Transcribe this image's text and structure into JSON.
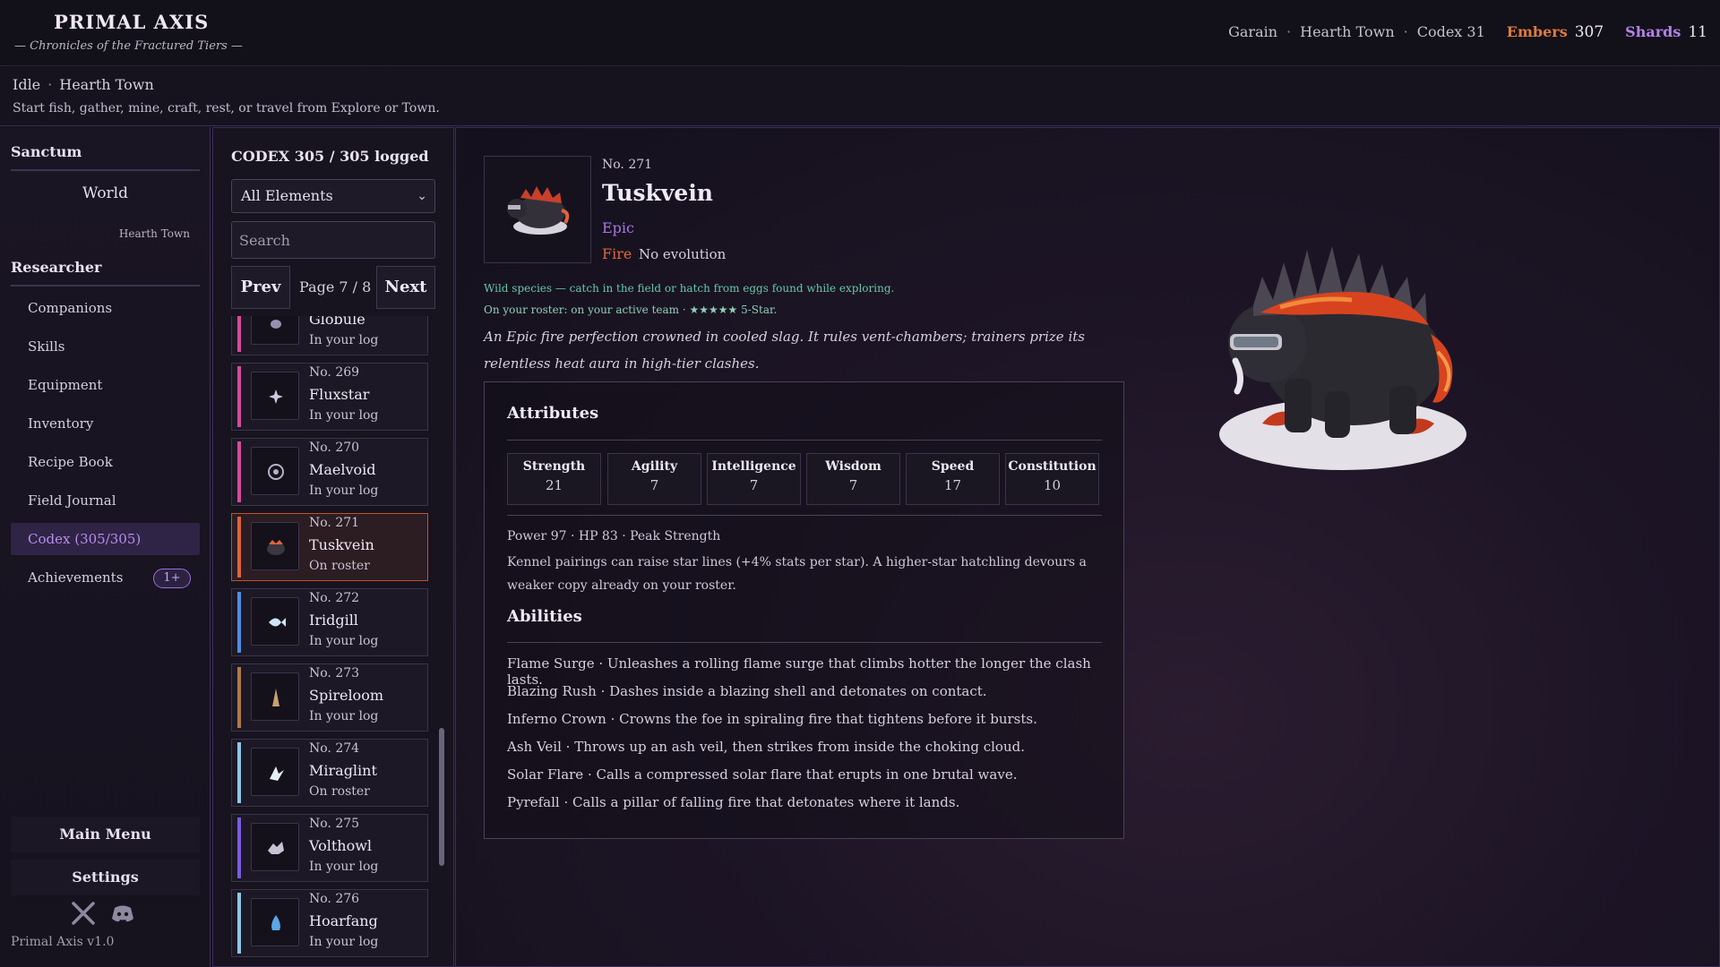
{
  "header": {
    "title": "PRIMAL AXIS",
    "subtitle": "— Chronicles of the Fractured Tiers —",
    "player": "Garain",
    "location": "Hearth Town",
    "codex": "Codex 31",
    "embers_label": "Embers",
    "embers_value": "307",
    "shards_label": "Shards",
    "shards_value": "11"
  },
  "status": {
    "state": "Idle",
    "location": "Hearth Town",
    "hint": "Start fish, gather, mine, craft, rest, or travel from Explore or Town."
  },
  "sidebar": {
    "sanctum": "Sanctum",
    "world": "World",
    "world_sub": "Hearth Town",
    "researcher": "Researcher",
    "items": [
      {
        "label": "Companions"
      },
      {
        "label": "Skills"
      },
      {
        "label": "Equipment"
      },
      {
        "label": "Inventory"
      },
      {
        "label": "Recipe Book"
      },
      {
        "label": "Field Journal"
      },
      {
        "label": "Codex (305/305)",
        "active": true
      },
      {
        "label": "Achievements",
        "badge": "1+"
      }
    ],
    "main_menu": "Main Menu",
    "settings": "Settings",
    "version": "Primal Axis  v1.0"
  },
  "codex": {
    "title": "CODEX  305 / 305 logged",
    "filter": "All Elements",
    "search_placeholder": "Search",
    "prev": "Prev",
    "next": "Next",
    "page": "Page 7 / 8",
    "entries": [
      {
        "num": "",
        "name": "Globule",
        "status": "In your log",
        "color": "#d64a9a",
        "icon": "blob-icon"
      },
      {
        "num": "No. 269",
        "name": "Fluxstar",
        "status": "In your log",
        "color": "#d64a9a",
        "icon": "star-icon"
      },
      {
        "num": "No. 270",
        "name": "Maelvoid",
        "status": "In your log",
        "color": "#d64a9a",
        "icon": "void-icon"
      },
      {
        "num": "No. 271",
        "name": "Tuskvein",
        "status": "On roster",
        "color": "#e0653a",
        "icon": "beast-icon",
        "selected": true
      },
      {
        "num": "No. 272",
        "name": "Iridgill",
        "status": "In your log",
        "color": "#4f8fe0",
        "icon": "fish-icon"
      },
      {
        "num": "No. 273",
        "name": "Spireloom",
        "status": "In your log",
        "color": "#b07a4a",
        "icon": "spire-icon"
      },
      {
        "num": "No. 274",
        "name": "Miraglint",
        "status": "On roster",
        "color": "#8ec8e8",
        "icon": "bird-icon"
      },
      {
        "num": "No. 275",
        "name": "Volthowl",
        "status": "In your log",
        "color": "#7b5ce0",
        "icon": "wolf-icon"
      },
      {
        "num": "No. 276",
        "name": "Hoarfang",
        "status": "In your log",
        "color": "#8ec8e8",
        "icon": "frost-icon"
      }
    ]
  },
  "detail": {
    "num": "No. 271",
    "name": "Tuskvein",
    "rarity": "Epic",
    "element": "Fire",
    "evolution": "No evolution",
    "wild": "Wild species — catch in the field or hatch from eggs found while exploring.",
    "roster": "On your roster: on your active team · ★★★★★ 5-Star.",
    "lore": "An Epic fire perfection crowned in cooled slag. It rules vent-chambers; trainers prize its relentless heat aura in high-tier clashes.",
    "attributes_title": "Attributes",
    "stats": [
      {
        "label": "Strength",
        "value": "21"
      },
      {
        "label": "Agility",
        "value": "7"
      },
      {
        "label": "Intelligence",
        "value": "7"
      },
      {
        "label": "Wisdom",
        "value": "7"
      },
      {
        "label": "Speed",
        "value": "17"
      },
      {
        "label": "Constitution",
        "value": "10"
      }
    ],
    "power_line": "Power 97  ·  HP 83  ·  Peak Strength",
    "kennel": "Kennel pairings can raise star lines (+4% stats per star). A higher-star hatchling devours a weaker copy already on your roster.",
    "abilities_title": "Abilities",
    "abilities": [
      "Flame Surge · Unleashes a rolling flame surge that climbs hotter the longer the clash lasts.",
      "Blazing Rush · Dashes inside a blazing shell and detonates on contact.",
      "Inferno Crown · Crowns the foe in spiraling fire that tightens before it bursts.",
      "Ash Veil · Throws up an ash veil, then strikes from inside the choking cloud.",
      "Solar Flare · Calls a compressed solar flare that erupts in one brutal wave.",
      "Pyrefall · Calls a pillar of falling fire that detonates where it lands."
    ]
  }
}
